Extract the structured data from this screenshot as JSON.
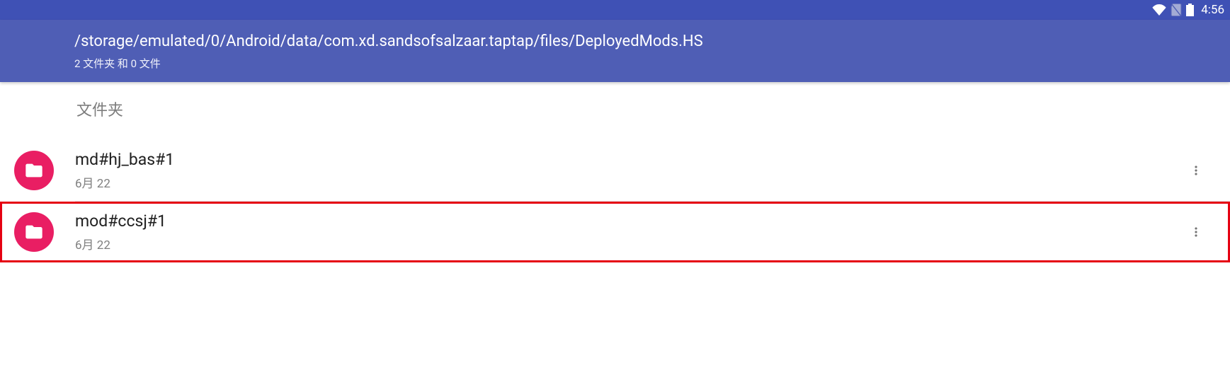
{
  "status_bar": {
    "time": "4:56"
  },
  "header": {
    "path": "/storage/emulated/0/Android/data/com.xd.sandsofsalzaar.taptap/files/DeployedMods.HS",
    "counts": "2 文件夹 和 0 文件"
  },
  "section": {
    "label": "文件夹"
  },
  "items": [
    {
      "name": "md#hj_bas#1",
      "date": "6月 22"
    },
    {
      "name": "mod#ccsj#1",
      "date": "6月 22"
    }
  ]
}
